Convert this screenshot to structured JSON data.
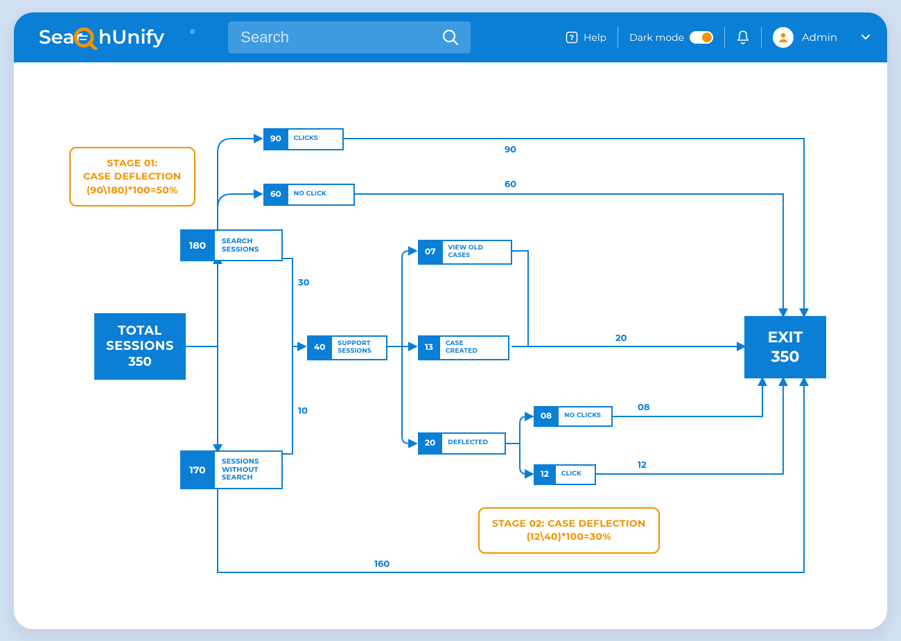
{
  "header": {
    "brand_a": "Sear",
    "brand_b": "hUnify",
    "search_placeholder": "Search",
    "help": "Help",
    "darkmode": "Dark mode",
    "user": "Admin"
  },
  "diagram": {
    "total_sessions": {
      "line1": "TOTAL",
      "line2": "SESSIONS",
      "value": "350"
    },
    "search_sessions": {
      "num": "180",
      "label": "SEARCH\nSESSIONS"
    },
    "sessions_without_search": {
      "num": "170",
      "label": "SESSIONS\nWITHOUT\nSEARCH"
    },
    "clicks": {
      "num": "90",
      "label": "CLICKS"
    },
    "no_click": {
      "num": "60",
      "label": "NO CLICK"
    },
    "support_sessions": {
      "num": "40",
      "label": "SUPPORT\nSESSIONS"
    },
    "view_old_cases": {
      "num": "07",
      "label": "VIEW OLD\nCASES"
    },
    "case_created": {
      "num": "13",
      "label": "CASE\nCREATED"
    },
    "deflected": {
      "num": "20",
      "label": "DEFLECTED"
    },
    "no_clicks2": {
      "num": "08",
      "label": "NO CLICKS"
    },
    "click2": {
      "num": "12",
      "label": "CLICK"
    },
    "exit": {
      "label": "EXIT",
      "value": "350"
    },
    "stage1": {
      "l1": "STAGE 01:",
      "l2": "CASE DEFLECTION",
      "l3": "(90\\180)*100=50%"
    },
    "stage2": {
      "l1": "STAGE 02: CASE DEFLECTION",
      "l2": "(12\\40)*100=30%"
    },
    "edges": {
      "e30": "30",
      "e10": "10",
      "e90": "90",
      "e60": "60",
      "e20": "20",
      "e160": "160",
      "e08": "08",
      "e12": "12"
    }
  }
}
